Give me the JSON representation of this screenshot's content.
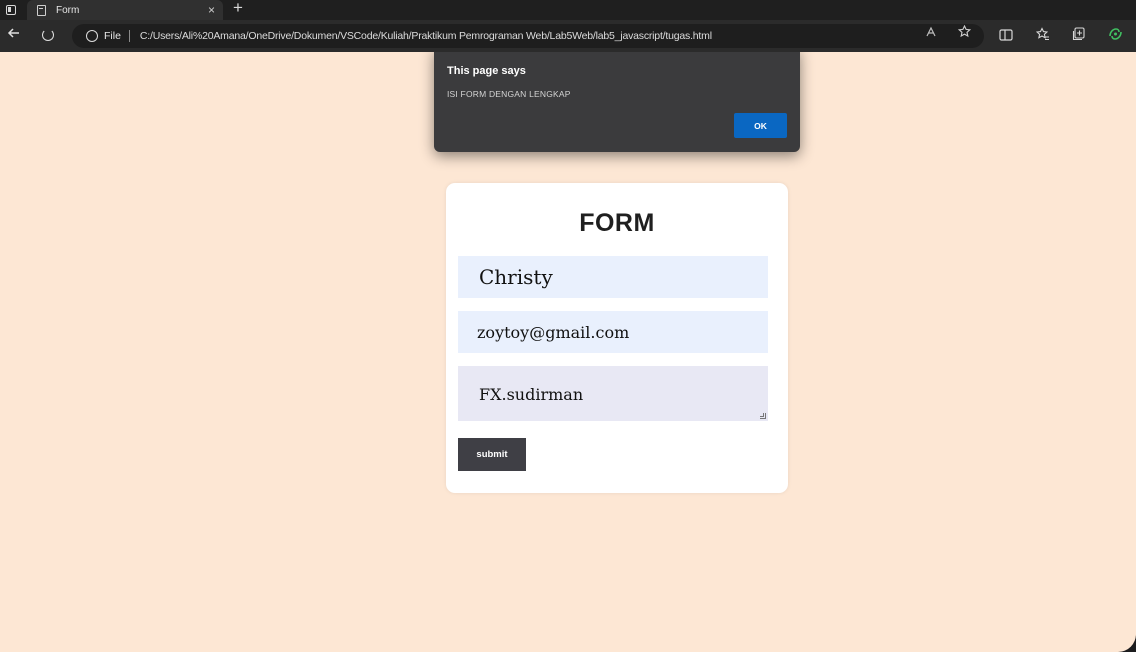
{
  "browser": {
    "tab": {
      "title": "Form",
      "close": "×"
    },
    "new_tab": "+",
    "address": {
      "scheme": "File",
      "url": "C:/Users/Ali%20Amana/OneDrive/Dokumen/VSCode/Kuliah/Praktikum Pemrograman Web/Lab5Web/lab5_javascript/tugas.html"
    },
    "icons": [
      "back-arrow-icon",
      "reload-icon",
      "info-icon",
      "read-aloud-icon",
      "favorite-star-icon",
      "split-screen-icon",
      "favorites-icon",
      "collections-icon",
      "copilot-icon"
    ],
    "colors": {
      "tabstrip": "#1f1f1f",
      "toolbar": "#2b2b2b",
      "omnibox": "#1e1e1e"
    }
  },
  "dialog": {
    "title": "This page says",
    "message": "ISI FORM DENGAN LENGKAP",
    "ok_label": "OK",
    "colors": {
      "background": "#3b3b3d",
      "ok_button": "#0a67c2"
    }
  },
  "form": {
    "title": "FORM",
    "name_value": "Christy",
    "email_value": "zoytoy@gmail.com",
    "address_value": "FX.sudirman",
    "submit_label": "submit",
    "colors": {
      "page_background": "#fde7d4",
      "card": "#ffffff",
      "input": "#e9f0fd",
      "submit": "#3f3f45"
    }
  }
}
